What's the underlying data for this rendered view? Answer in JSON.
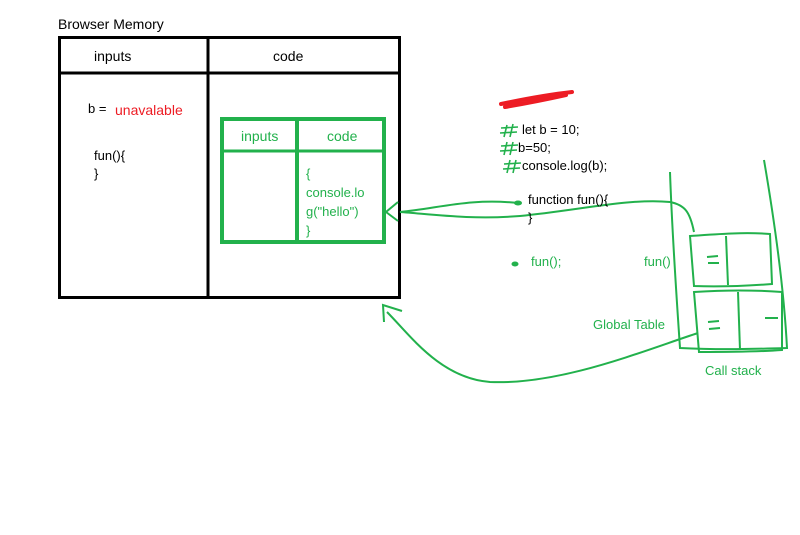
{
  "colors": {
    "ink": "#000000",
    "accent_green": "#22b14c",
    "error_red": "#ed1c24",
    "background": "#ffffff"
  },
  "memory": {
    "title": "Browser Memory",
    "col_inputs": "inputs",
    "col_code": "code",
    "var_label": "b =",
    "var_value": "unavalable",
    "func_line1": "fun(){",
    "func_line2": "}"
  },
  "inner_table": {
    "col_inputs": "inputs",
    "col_code": "code",
    "code_lines": [
      "{",
      "console.lo",
      "g(\"hello\")",
      "}"
    ]
  },
  "code_snippet": {
    "lines": [
      "let b = 10;",
      "b=50;",
      "console.log(b);"
    ],
    "func_lines": [
      "function fun(){",
      "}"
    ],
    "call": "fun();"
  },
  "call_stack": {
    "frame_fun": "fun()",
    "frame_global": "Global Table",
    "caption": "Call stack"
  }
}
